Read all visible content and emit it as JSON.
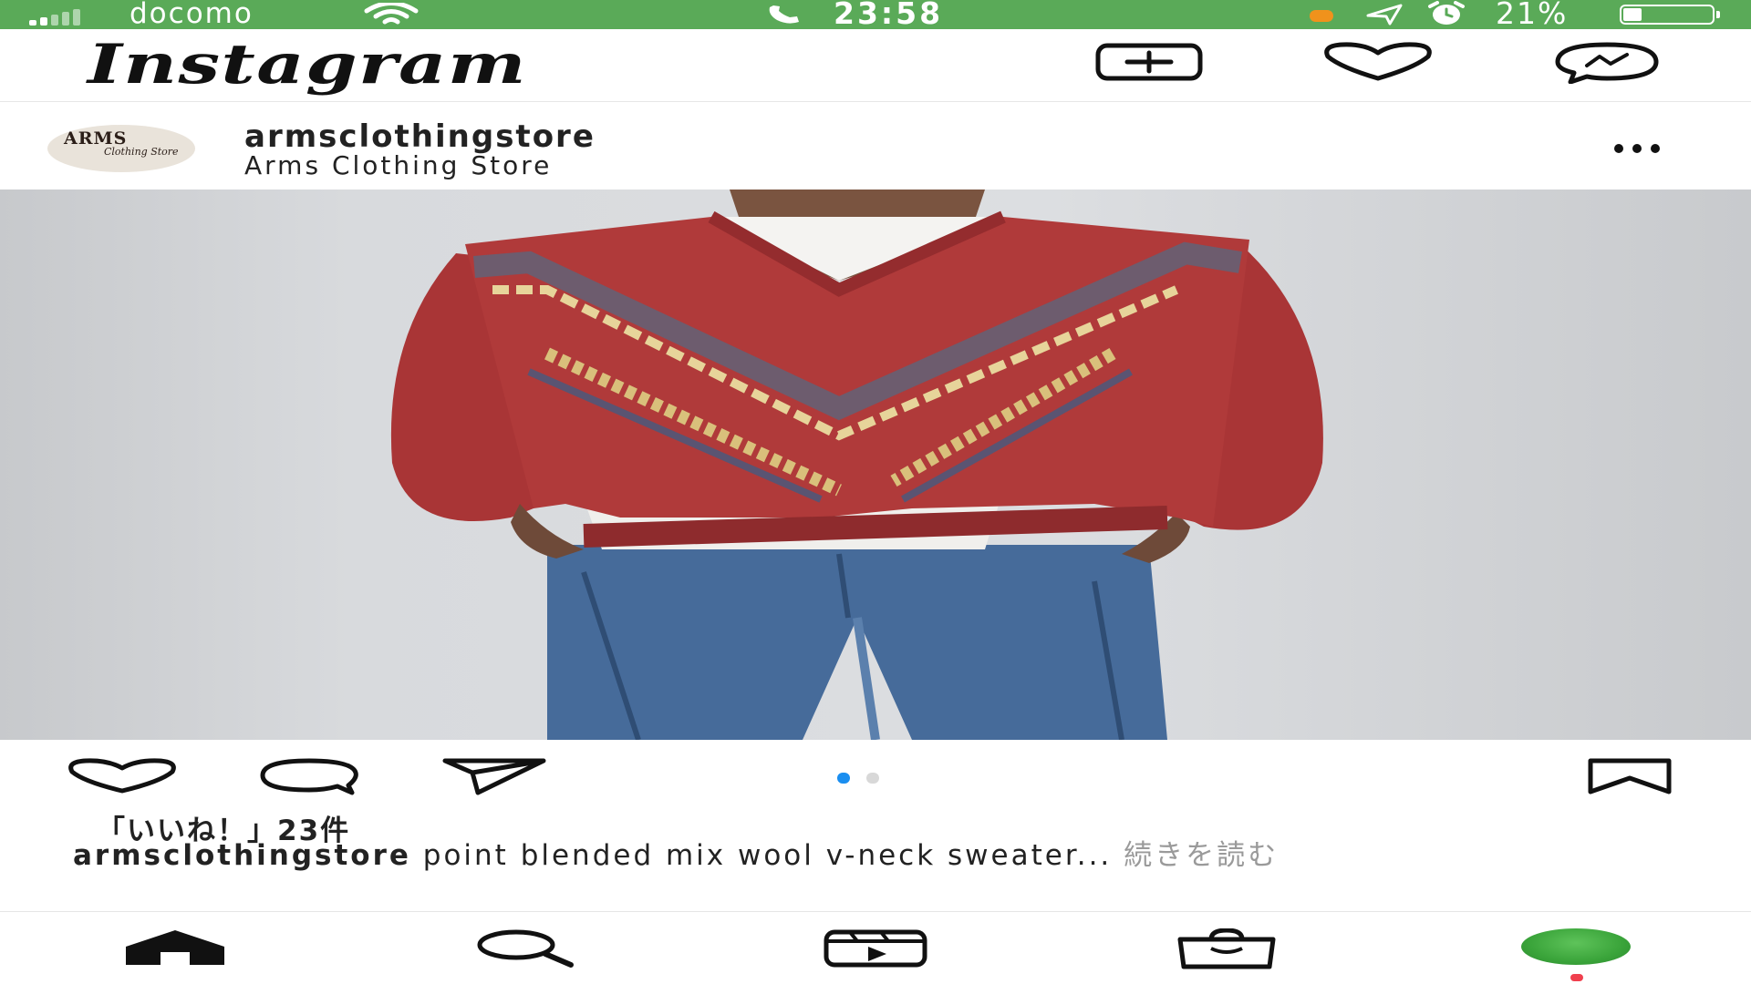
{
  "status_bar": {
    "carrier": "docomo",
    "time": "23:58",
    "battery_percent": "21%",
    "battery_level": 0.21,
    "signal_bars": 2,
    "icons": [
      "signal-icon",
      "wifi-icon",
      "phone-icon",
      "location-icon",
      "alarm-icon",
      "battery-icon"
    ],
    "color": "#5aaa58"
  },
  "header": {
    "logo": "Instagram",
    "icons": [
      "new-post-icon",
      "heart-icon",
      "messenger-icon"
    ]
  },
  "post": {
    "avatar_line1": "ARMS",
    "avatar_line2": "Clothing Store",
    "username": "armsclothingstore",
    "store_name": "Arms Clothing Store",
    "image_description_icons": [
      "sweater-photo"
    ],
    "carousel_total": 2,
    "carousel_active": 1,
    "likes": "「いいね！」23件",
    "caption_user": "armsclothingstore",
    "caption_text": " point blended mix wool v-neck sweater...",
    "caption_more": " 続きを読む"
  },
  "bottom_nav": {
    "items": [
      "home-icon",
      "search-icon",
      "reels-icon",
      "shop-icon",
      "profile-avatar"
    ],
    "accent": "#f0404e"
  }
}
